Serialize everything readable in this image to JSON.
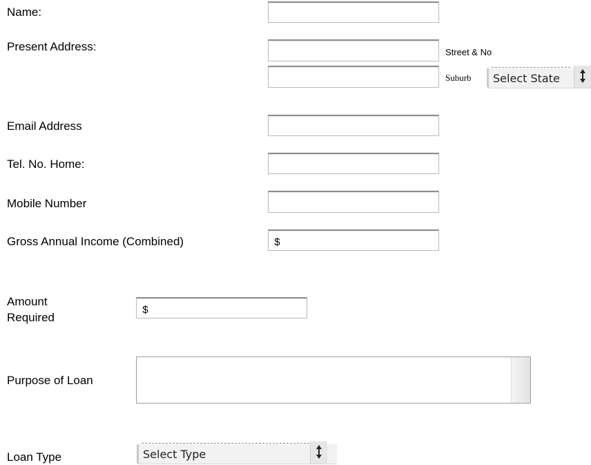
{
  "form": {
    "name": {
      "label": "Name:",
      "value": ""
    },
    "present_address": {
      "label": "Present Address:",
      "street_value": "",
      "street_hint": "Street & No",
      "suburb_value": "",
      "suburb_hint": "Suburb",
      "state_select": "Select State"
    },
    "email": {
      "label": "Email Address",
      "value": ""
    },
    "tel_home": {
      "label": "Tel. No. Home:",
      "value": ""
    },
    "mobile": {
      "label": "Mobile Number",
      "value": ""
    },
    "income": {
      "label": "Gross Annual Income (Combined)",
      "value": "$"
    },
    "amount": {
      "label_line1": "Amount",
      "label_line2": "Required",
      "value": "$"
    },
    "purpose": {
      "label": "Purpose of Loan",
      "value": ""
    },
    "loan_type": {
      "label": "Loan Type",
      "select": "Select Type"
    }
  },
  "icons": {
    "select_arrow": "updown-arrow-icon"
  }
}
